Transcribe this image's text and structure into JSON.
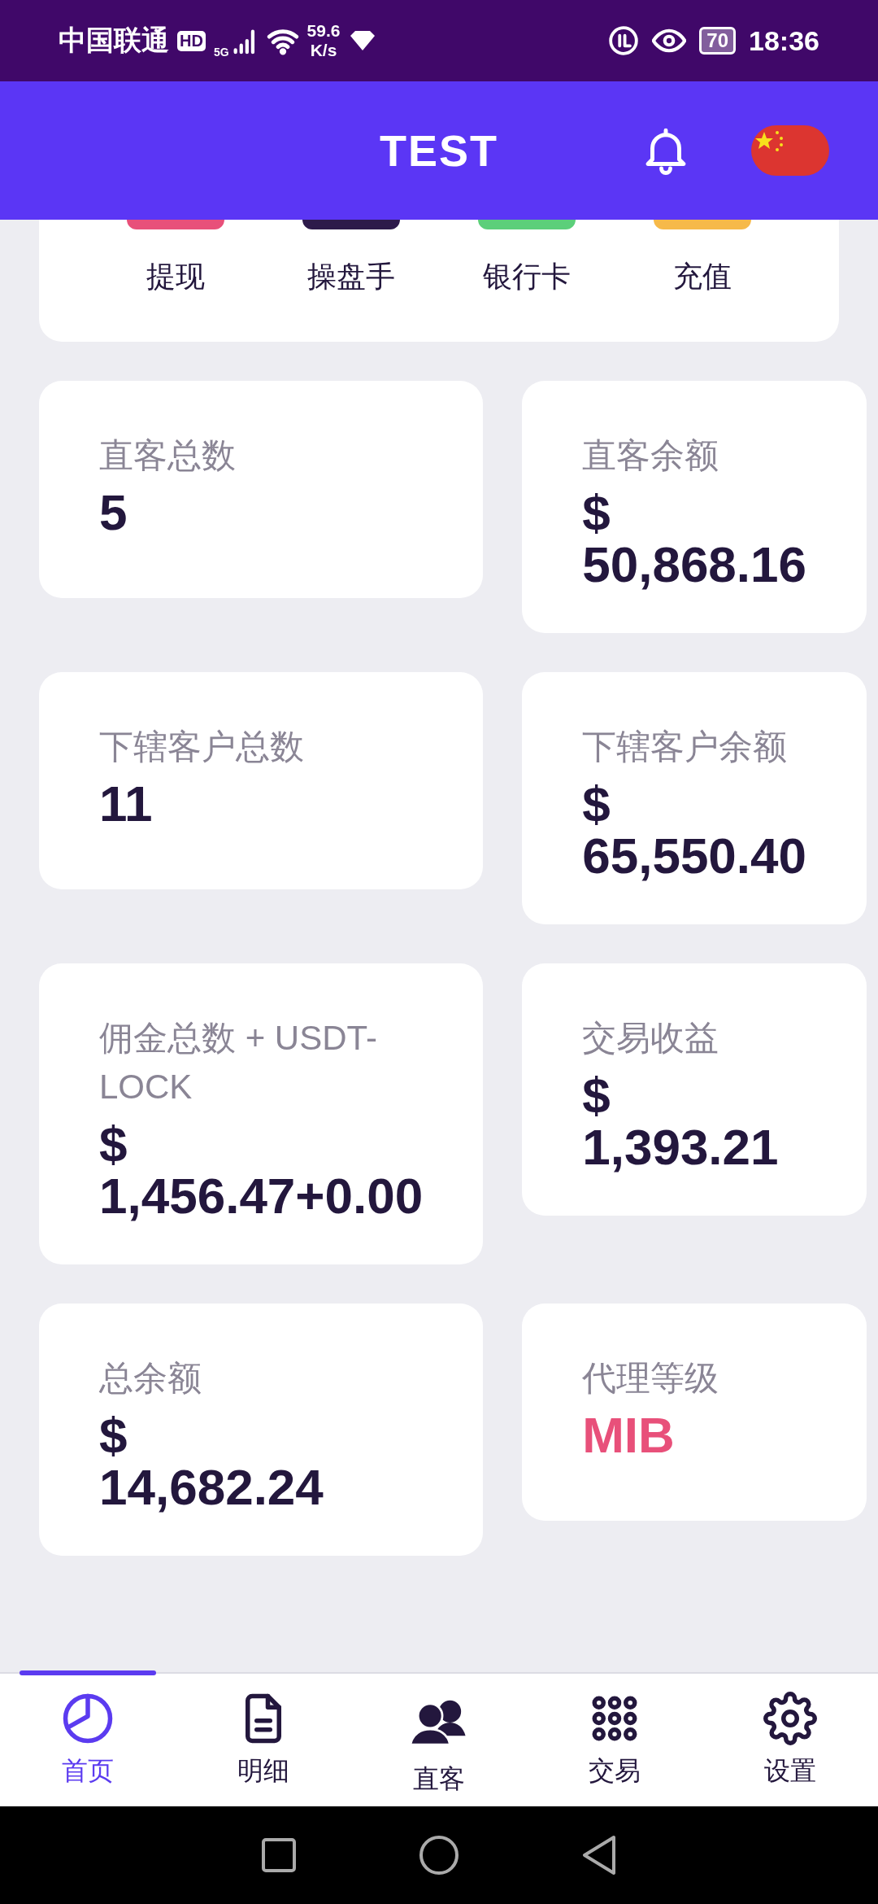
{
  "status_bar": {
    "carrier": "中国联通",
    "hd": "HD",
    "network": "5G",
    "speed_value": "59.6",
    "speed_unit": "K/s",
    "battery": "70",
    "time": "18:36"
  },
  "header": {
    "title": "TEST"
  },
  "quick_actions": [
    {
      "label": "提现",
      "color": "#e8507a"
    },
    {
      "label": "操盘手",
      "color": "#2d1a4a"
    },
    {
      "label": "银行卡",
      "color": "#5ccf7a"
    },
    {
      "label": "充值",
      "color": "#f6b94a"
    }
  ],
  "stats": [
    {
      "label": "直客总数",
      "value": "5",
      "kind": "number"
    },
    {
      "label": "直客余额",
      "value": "$ 50,868.16",
      "kind": "number"
    },
    {
      "label": "下辖客户总数",
      "value": "11",
      "kind": "number"
    },
    {
      "label": "下辖客户余额",
      "value": "$ 65,550.40",
      "kind": "number"
    },
    {
      "label": "佣金总数 + USDT-LOCK",
      "value": "$ 1,456.47+0.00",
      "kind": "number"
    },
    {
      "label": "交易收益",
      "value": "$ 1,393.21",
      "kind": "number"
    },
    {
      "label": "总余额",
      "value": "$ 14,682.24",
      "kind": "number"
    },
    {
      "label": "代理等级",
      "value": "MIB",
      "kind": "level"
    }
  ],
  "bottom_nav": [
    {
      "label": "首页",
      "kind": "chart",
      "selected": true
    },
    {
      "label": "明细",
      "kind": "document",
      "selected": false
    },
    {
      "label": "直客",
      "kind": "users",
      "selected": false
    },
    {
      "label": "交易",
      "kind": "grid",
      "selected": false
    },
    {
      "label": "设置",
      "kind": "settings",
      "selected": false
    }
  ]
}
